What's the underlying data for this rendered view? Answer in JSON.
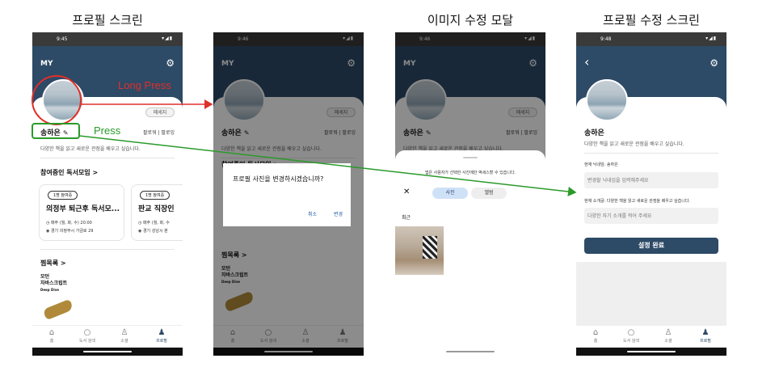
{
  "captions": [
    "프로필 스크린",
    "이미지 수정 모달",
    "프로필 수정 스크린"
  ],
  "annotations": {
    "long_press": "Long Press",
    "press": "Press"
  },
  "status": {
    "times": [
      "9:45",
      "9:46",
      "9:46",
      "9:48"
    ],
    "icons": "▾◢▮"
  },
  "header": {
    "title": "MY"
  },
  "profile": {
    "message_button": "메세지",
    "name": "송하은",
    "followers": "팔로워",
    "following": "팔로잉",
    "bio": "다양한 책을 읽고 새로운 관점을 배우고 싶습니다."
  },
  "meetings": {
    "section_title": "참여중인 독서모임 >",
    "cards": [
      {
        "badge": "1명 참여중",
        "title": "의정부 퇴근후 독서모...",
        "schedule": "매주 (월, 화, 수) 20:00",
        "location": "경기 의정부시 가금로 29"
      },
      {
        "badge": "1명 참여중",
        "title": "판교 직장인",
        "schedule": "매주 (월, 화, 수",
        "location": "경기 성남시 분"
      }
    ]
  },
  "wishlist": {
    "section_title": "찜목록 >",
    "book": {
      "line1": "모던",
      "line2": "자바스크립트",
      "line3": "Deep Dive"
    }
  },
  "nav": {
    "items": [
      {
        "icon": "home-icon",
        "label": "홈"
      },
      {
        "icon": "search-icon",
        "label": "도서 검색"
      },
      {
        "icon": "people-icon",
        "label": "소셜"
      },
      {
        "icon": "person-icon",
        "label": "프로필"
      }
    ]
  },
  "dialog": {
    "question": "프로필 사진을 변경하시겠습니까?",
    "cancel": "취소",
    "confirm": "변경"
  },
  "image_modal": {
    "permission_text": "앱은 사용자가 선택한 사진에만 액세스할 수 있습니다.",
    "close": "✕",
    "tab_photos": "사진",
    "tab_albums": "앨범",
    "recent": "최근"
  },
  "edit": {
    "nickname_label": "현재 닉네임: 송하은",
    "nickname_placeholder": "변경할 닉네임을 입력해주세요",
    "bio_label": "현재 소개글: 다양한 책을 읽고 새로운 관점을 배우고 싶습니다.",
    "bio_placeholder": "다양한 자기 소개를 적어 주세요",
    "submit": "설정 완료"
  },
  "colors": {
    "header": "#2d4a66",
    "red_annotation": "#e0302b",
    "green_annotation": "#2a9a2a",
    "link": "#1e5aa8"
  }
}
